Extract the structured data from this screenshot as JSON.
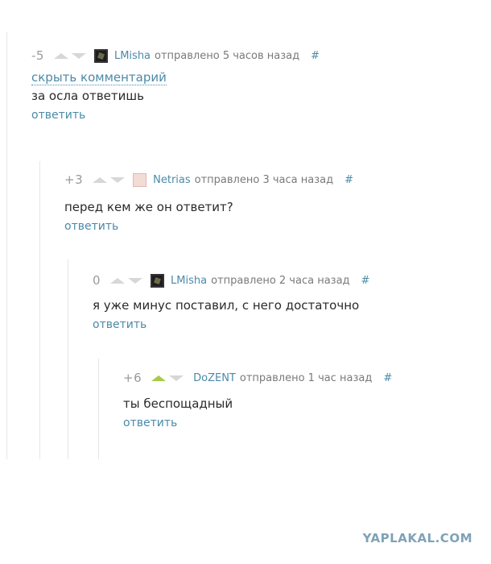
{
  "comments": [
    {
      "rating": "-5",
      "author": "LMisha",
      "posted": "отправлено 5 часов назад",
      "hash": "#",
      "hide_label": "скрыть комментарий",
      "text": "за осла ответишь",
      "reply_label": "ответить",
      "avatar_icon": "dark-square-avatar",
      "upvoted": false
    },
    {
      "rating": "+3",
      "author": "Netrias",
      "posted": "отправлено 3 часа назад",
      "hash": "#",
      "text": "перед кем же он ответит?",
      "reply_label": "ответить",
      "avatar_icon": "pink-face-avatar",
      "upvoted": false
    },
    {
      "rating": "0",
      "author": "LMisha",
      "posted": "отправлено 2 часа назад",
      "hash": "#",
      "text": "я уже минус поставил, с него достаточно",
      "reply_label": "ответить",
      "avatar_icon": "dark-square-avatar",
      "upvoted": false
    },
    {
      "rating": "+6",
      "author": "DoZENT",
      "posted": "отправлено 1 час назад",
      "hash": "#",
      "text": "ты беспощадный",
      "reply_label": "ответить",
      "avatar_icon": "none",
      "upvoted": true
    }
  ],
  "watermark": "YAPLAKAL.COM",
  "colors": {
    "link": "#4b8aa8",
    "meta": "#7a7a7a",
    "arrow_inactive": "#d7d7d7",
    "arrow_active": "#a9c94a",
    "watermark": "#7fa2b7"
  }
}
